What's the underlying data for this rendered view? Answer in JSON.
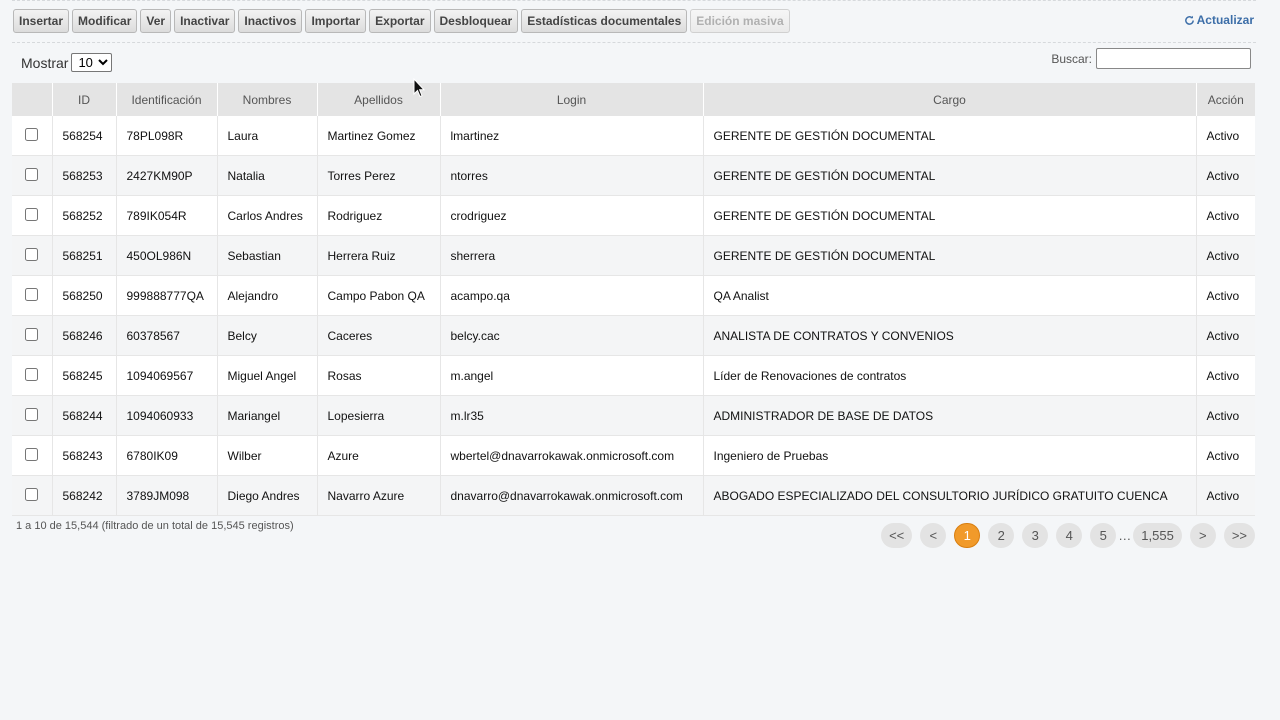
{
  "toolbar": {
    "buttons": [
      "Insertar",
      "Modificar",
      "Ver",
      "Inactivar",
      "Inactivos",
      "Importar",
      "Exportar",
      "Desbloquear",
      "Estadísticas documentales"
    ],
    "disabled_button": "Edición masiva",
    "refresh_label": "Actualizar",
    "refresh_icon": "refresh-icon"
  },
  "length": {
    "label": "Mostrar",
    "selected": "10",
    "options": [
      "10"
    ]
  },
  "search": {
    "label": "Buscar:",
    "value": ""
  },
  "table": {
    "columns": [
      "",
      "ID",
      "Identificación",
      "Nombres",
      "Apellidos",
      "Login",
      "Cargo",
      "Acción"
    ],
    "rows": [
      {
        "id": "568254",
        "identificacion": "78PL098R",
        "nombres": "Laura",
        "apellidos": "Martinez Gomez",
        "login": "lmartinez",
        "cargo": "GERENTE DE GESTIÓN DOCUMENTAL",
        "accion": "Activo"
      },
      {
        "id": "568253",
        "identificacion": "2427KM90P",
        "nombres": "Natalia",
        "apellidos": "Torres Perez",
        "login": "ntorres",
        "cargo": "GERENTE DE GESTIÓN DOCUMENTAL",
        "accion": "Activo"
      },
      {
        "id": "568252",
        "identificacion": "789IK054R",
        "nombres": "Carlos Andres",
        "apellidos": "Rodriguez",
        "login": "crodriguez",
        "cargo": "GERENTE DE GESTIÓN DOCUMENTAL",
        "accion": "Activo"
      },
      {
        "id": "568251",
        "identificacion": "450OL986N",
        "nombres": "Sebastian",
        "apellidos": "Herrera Ruiz",
        "login": "sherrera",
        "cargo": "GERENTE DE GESTIÓN DOCUMENTAL",
        "accion": "Activo"
      },
      {
        "id": "568250",
        "identificacion": "999888777QA",
        "nombres": "Alejandro",
        "apellidos": "Campo Pabon QA",
        "login": "acampo.qa",
        "cargo": "QA Analist",
        "accion": "Activo"
      },
      {
        "id": "568246",
        "identificacion": "60378567",
        "nombres": "Belcy",
        "apellidos": "Caceres",
        "login": "belcy.cac",
        "cargo": "ANALISTA DE CONTRATOS Y CONVENIOS",
        "accion": "Activo"
      },
      {
        "id": "568245",
        "identificacion": "1094069567",
        "nombres": "Miguel Angel",
        "apellidos": "Rosas",
        "login": "m.angel",
        "cargo": "Líder de Renovaciones de contratos",
        "accion": "Activo"
      },
      {
        "id": "568244",
        "identificacion": "1094060933",
        "nombres": "Mariangel",
        "apellidos": "Lopesierra",
        "login": "m.lr35",
        "cargo": "ADMINISTRADOR DE BASE DE DATOS",
        "accion": "Activo"
      },
      {
        "id": "568243",
        "identificacion": "6780IK09",
        "nombres": "Wilber",
        "apellidos": "Azure",
        "login": "wbertel@dnavarrokawak.onmicrosoft.com",
        "cargo": "Ingeniero de Pruebas",
        "accion": "Activo"
      },
      {
        "id": "568242",
        "identificacion": "3789JM098",
        "nombres": "Diego Andres",
        "apellidos": "Navarro Azure",
        "login": "dnavarro@dnavarrokawak.onmicrosoft.com",
        "cargo": "ABOGADO ESPECIALIZADO DEL CONSULTORIO JURÍDICO GRATUITO CUENCA",
        "accion": "Activo"
      }
    ]
  },
  "info": "1 a 10 de 15,544 (filtrado de un total de 15,545 registros)",
  "pagination": {
    "first": "<<",
    "prev": "<",
    "pages": [
      "1",
      "2",
      "3",
      "4",
      "5"
    ],
    "ellipsis": "…",
    "last_page": "1,555",
    "next": ">",
    "last": ">>",
    "active": "1",
    "active_color": "#f19a2a"
  },
  "colors": {
    "link": "#3c6ea8",
    "header_bg": "#e4e4e4",
    "page_bg": "#f4f6f8"
  }
}
